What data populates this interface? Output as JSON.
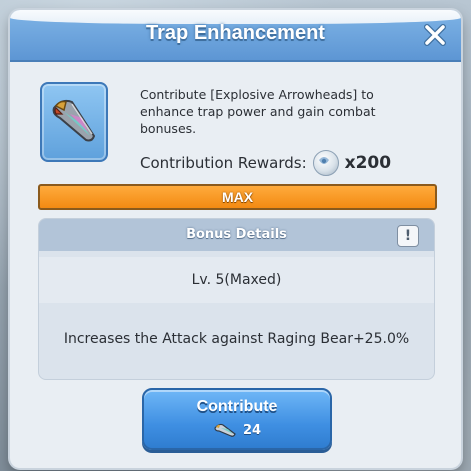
{
  "window": {
    "title": "Trap Enhancement",
    "close_icon": "close-icon"
  },
  "item": {
    "icon": "explosive-arrowhead-icon",
    "description": "Contribute [Explosive Arrowheads] to enhance trap power and gain combat bonuses.",
    "rewards_label": "Contribution Rewards:",
    "reward_icon": "contribution-token-icon",
    "reward_count": "x200"
  },
  "progress": {
    "label": "MAX",
    "fill_fraction": 1.0,
    "color": "#f38a12"
  },
  "bonus": {
    "title": "Bonus Details",
    "info_icon": "info-icon",
    "info_label": "!",
    "level": "Lv. 5(Maxed)",
    "effect": "Increases the Attack against Raging Bear+25.0%"
  },
  "action": {
    "button_label": "Contribute",
    "cost_icon": "explosive-arrowhead-icon",
    "cost": "24"
  },
  "colors": {
    "header": "#5d96d4",
    "accent": "#3f8fe2",
    "max_bar": "#f38a12"
  }
}
